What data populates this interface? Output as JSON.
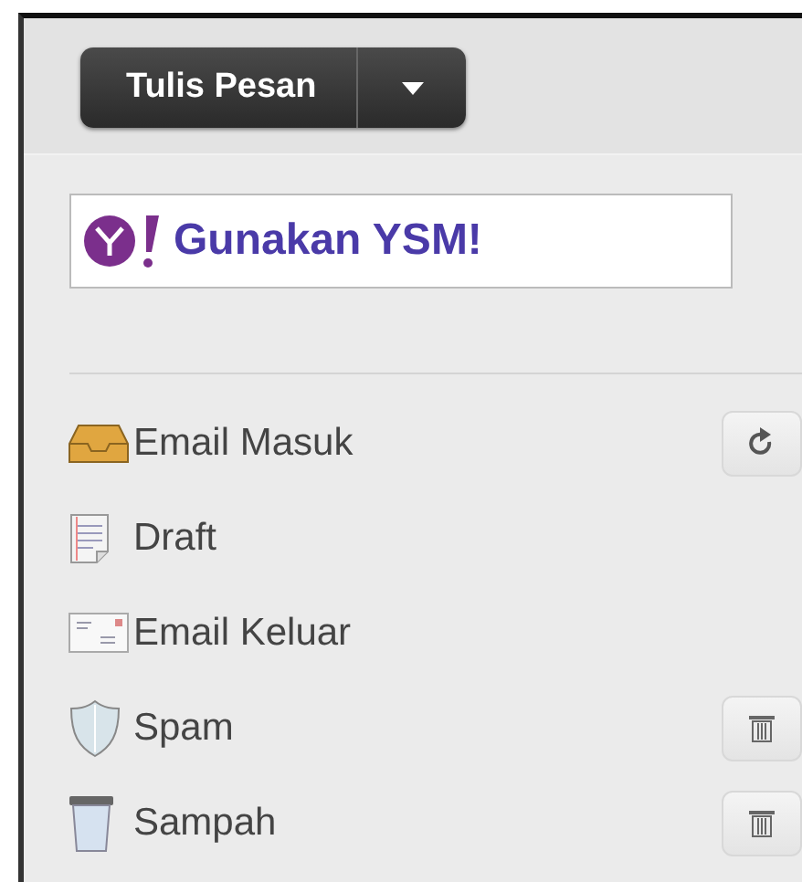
{
  "compose": {
    "label": "Tulis Pesan"
  },
  "ad": {
    "text": "Gunakan YSM!"
  },
  "folders": [
    {
      "label": "Email Masuk"
    },
    {
      "label": "Draft"
    },
    {
      "label": "Email Keluar"
    },
    {
      "label": "Spam"
    },
    {
      "label": "Sampah"
    }
  ]
}
